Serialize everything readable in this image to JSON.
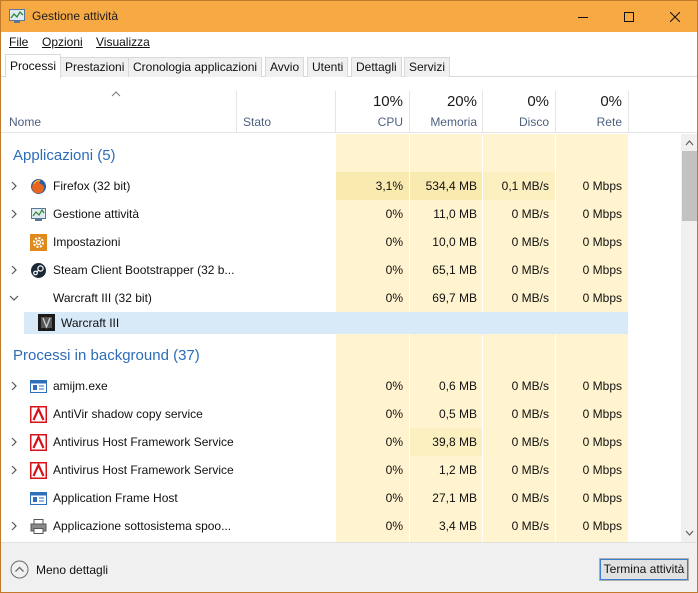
{
  "window": {
    "title": "Gestione attività",
    "accent": "#f7a944"
  },
  "menu": [
    {
      "label": "File"
    },
    {
      "label": "Opzioni"
    },
    {
      "label": "Visualizza"
    }
  ],
  "tabs": [
    {
      "label": "Processi",
      "active": true
    },
    {
      "label": "Prestazioni"
    },
    {
      "label": "Cronologia applicazioni"
    },
    {
      "label": "Avvio"
    },
    {
      "label": "Utenti"
    },
    {
      "label": "Dettagli"
    },
    {
      "label": "Servizi"
    }
  ],
  "columns": {
    "name": "Nome",
    "status": "Stato",
    "cpu": {
      "pct": "10%",
      "label": "CPU"
    },
    "memory": {
      "pct": "20%",
      "label": "Memoria"
    },
    "disk": {
      "pct": "0%",
      "label": "Disco"
    },
    "network": {
      "pct": "0%",
      "label": "Rete"
    }
  },
  "groups": {
    "apps": "Applicazioni (5)",
    "background": "Processi in background (37)"
  },
  "rows": [
    {
      "name": "Firefox (32 bit)",
      "icon": "firefox-icon",
      "cpu": "3,1%",
      "mem": "534,4 MB",
      "disk": "0,1 MB/s",
      "net": "0 Mbps"
    },
    {
      "name": "Gestione attività",
      "icon": "task-manager-icon",
      "cpu": "0%",
      "mem": "11,0 MB",
      "disk": "0 MB/s",
      "net": "0 Mbps"
    },
    {
      "name": "Impostazioni",
      "icon": "settings-gear-icon",
      "cpu": "0%",
      "mem": "10,0 MB",
      "disk": "0 MB/s",
      "net": "0 Mbps"
    },
    {
      "name": "Steam Client Bootstrapper (32 b...",
      "icon": "steam-icon",
      "cpu": "0%",
      "mem": "65,1 MB",
      "disk": "0 MB/s",
      "net": "0 Mbps"
    },
    {
      "name": "Warcraft III (32 bit)",
      "icon": "",
      "cpu": "0%",
      "mem": "69,7 MB",
      "disk": "0 MB/s",
      "net": "0 Mbps"
    },
    {
      "name": "Warcraft III",
      "icon": "warcraft-icon"
    },
    {
      "name": "amijm.exe",
      "icon": "window-app-icon",
      "cpu": "0%",
      "mem": "0,6 MB",
      "disk": "0 MB/s",
      "net": "0 Mbps"
    },
    {
      "name": "AntiVir shadow copy service",
      "icon": "avira-icon",
      "cpu": "0%",
      "mem": "0,5 MB",
      "disk": "0 MB/s",
      "net": "0 Mbps"
    },
    {
      "name": "Antivirus Host Framework Service",
      "icon": "avira-icon",
      "cpu": "0%",
      "mem": "39,8 MB",
      "disk": "0 MB/s",
      "net": "0 Mbps"
    },
    {
      "name": "Antivirus Host Framework Service",
      "icon": "avira-icon",
      "cpu": "0%",
      "mem": "1,2 MB",
      "disk": "0 MB/s",
      "net": "0 Mbps"
    },
    {
      "name": "Application Frame Host",
      "icon": "window-app-icon",
      "cpu": "0%",
      "mem": "27,1 MB",
      "disk": "0 MB/s",
      "net": "0 Mbps"
    },
    {
      "name": "Applicazione sottosistema spoo...",
      "icon": "printer-icon",
      "cpu": "0%",
      "mem": "3,4 MB",
      "disk": "0 MB/s",
      "net": "0 Mbps"
    }
  ],
  "footer": {
    "less_details": "Meno dettagli",
    "end_task": "Termina attività"
  }
}
